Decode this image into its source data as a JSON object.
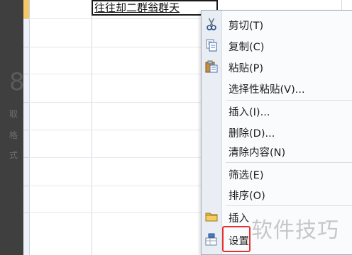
{
  "left_panel": {
    "big_digit": "8",
    "side_labels": [
      "取",
      "格",
      "式"
    ]
  },
  "cell": {
    "content": "往往却二群翁群天"
  },
  "context_menu": {
    "items": [
      {
        "label": "剪切(T)",
        "icon": "scissors-icon"
      },
      {
        "label": "复制(C)",
        "icon": "copy-icon"
      },
      {
        "label": "粘贴(P)",
        "icon": "paste-icon"
      },
      {
        "label": "选择性粘贴(V)...",
        "icon": ""
      },
      {
        "label": "插入(I)...",
        "icon": ""
      },
      {
        "label": "删除(D)...",
        "icon": ""
      },
      {
        "label": "清除内容(N)",
        "icon": ""
      },
      {
        "label": "筛选(E)",
        "icon": ""
      },
      {
        "label": "排序(O)",
        "icon": ""
      },
      {
        "label": "插入",
        "icon": "folder-icon"
      },
      {
        "label": "设置",
        "icon": "format-icon"
      }
    ]
  },
  "watermark": "软件技巧",
  "colors": {
    "highlight": "#e8312f",
    "row_header_selected": "#f7c766"
  }
}
